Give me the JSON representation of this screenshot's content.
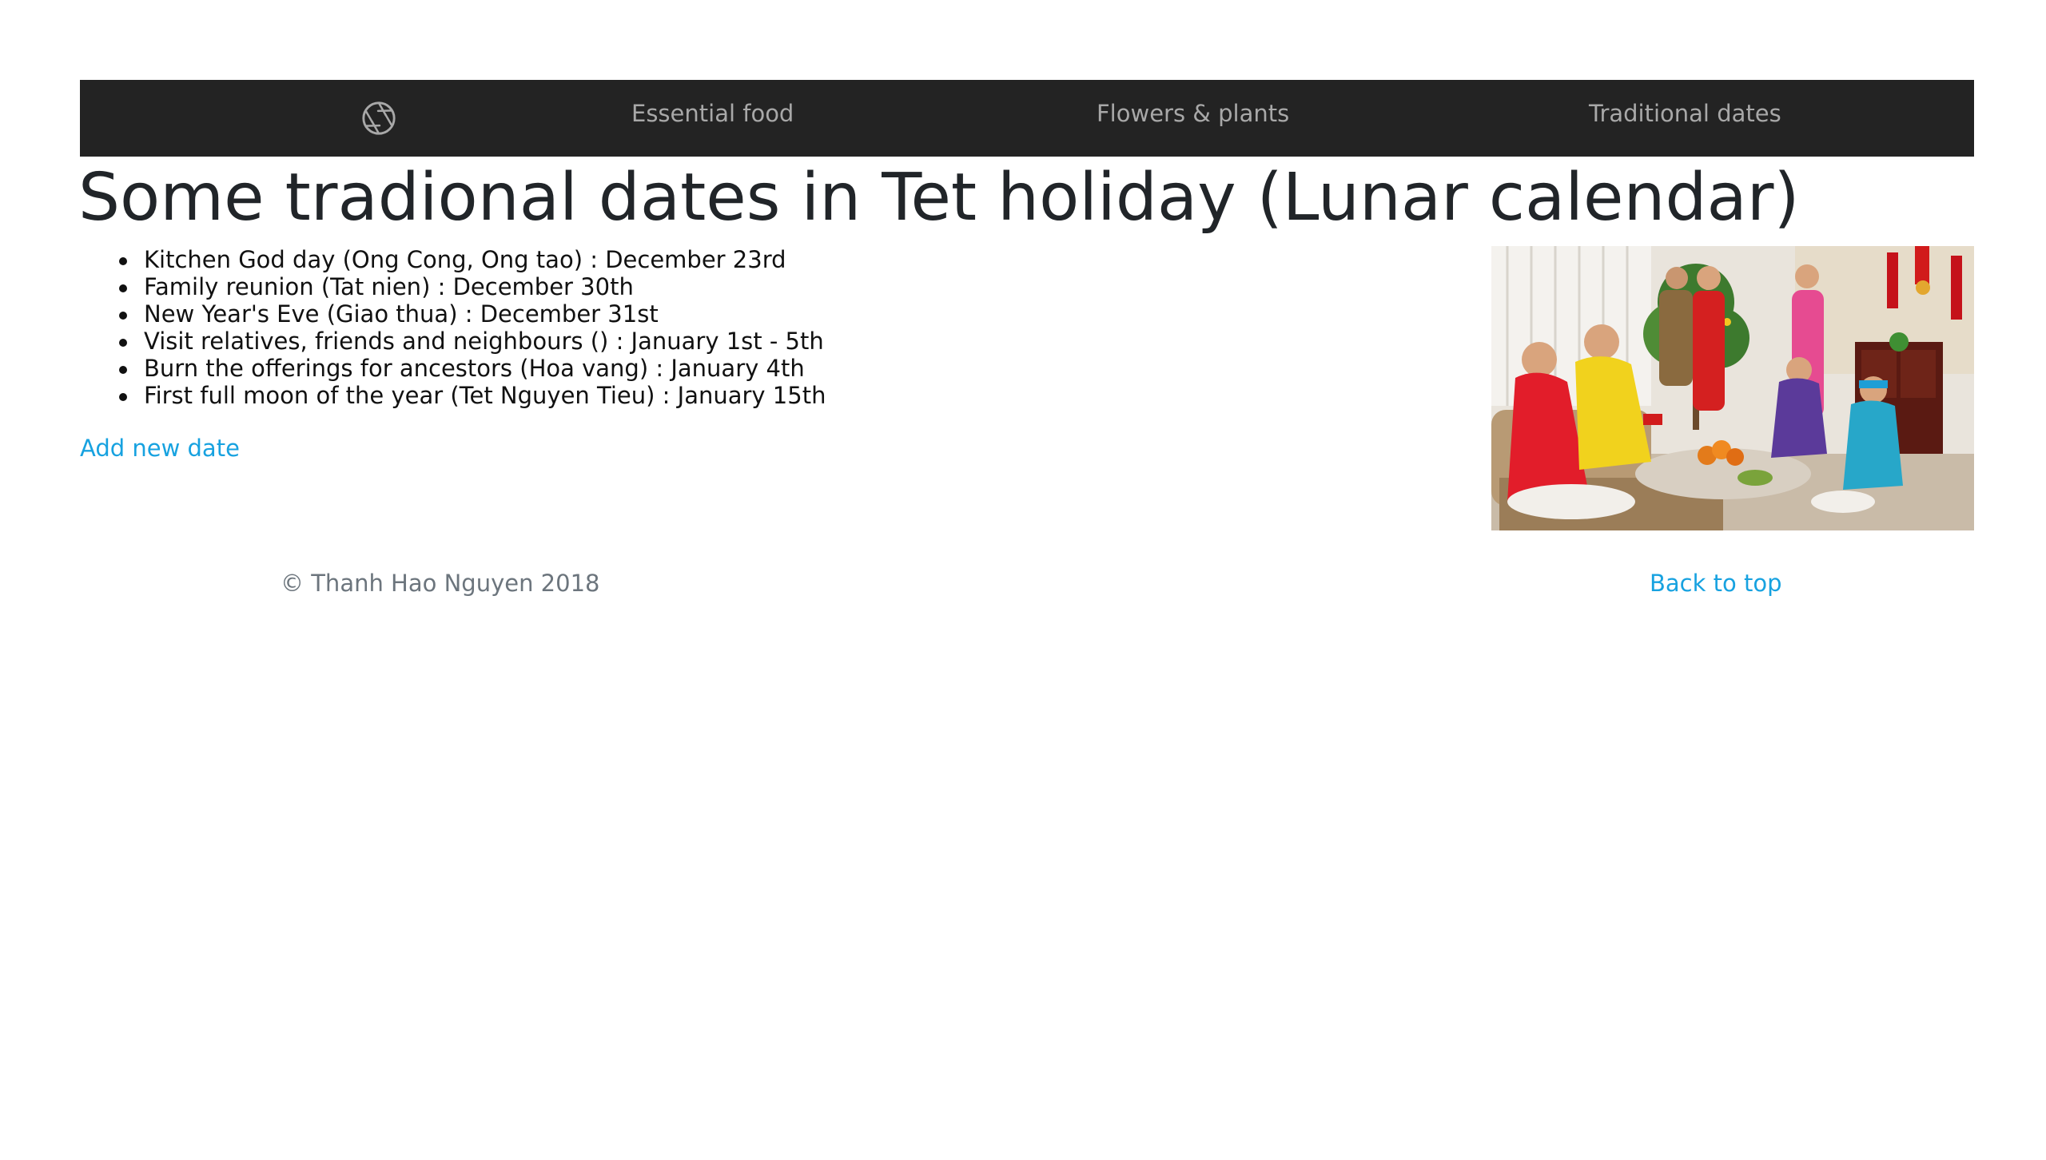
{
  "nav": {
    "logo_icon": "camera-aperture-icon",
    "links": [
      "Essential food",
      "Flowers & plants",
      "Traditional dates"
    ]
  },
  "main": {
    "title": "Some tradional dates in Tet holiday (Lunar calendar)",
    "dates": [
      "Kitchen God day (Ong Cong, Ong tao) : December 23rd",
      "Family reunion (Tat nien) : December 30th",
      "New Year's Eve (Giao thua) : December 31st",
      "Visit relatives, friends and neighbours () : January 1st - 5th",
      "Burn the offerings for ancestors (Hoa vang) : January 4th",
      "First full moon of the year (Tet Nguyen Tieu) : January 15th"
    ],
    "add_link": "Add new date"
  },
  "footer": {
    "copyright": "© Thanh Hao Nguyen 2018",
    "back_to_top": "Back to top"
  },
  "colors": {
    "navbar_bg": "#232323",
    "nav_text": "#a8a8a8",
    "link": "#17a2e0",
    "muted": "#6c757d"
  }
}
